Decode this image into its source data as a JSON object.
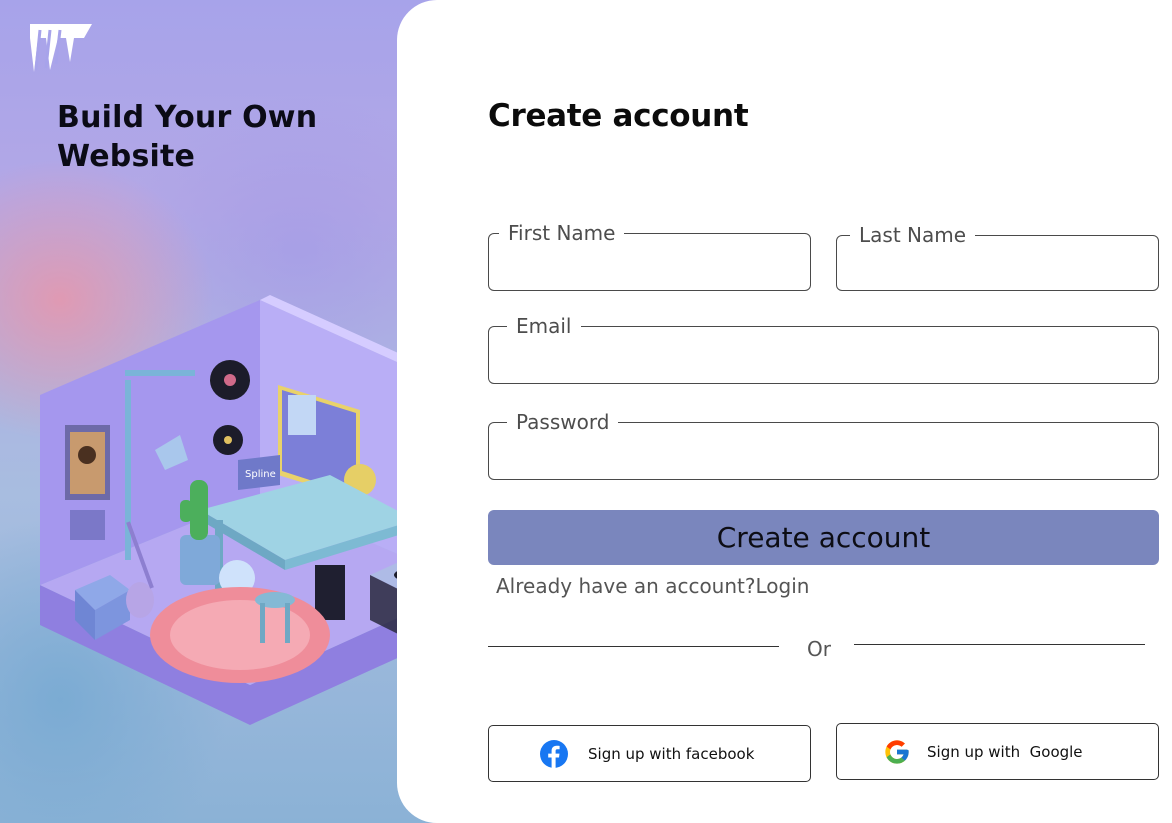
{
  "hero": {
    "title_line1": "Build Your Own",
    "title_line2": "Website",
    "logo_icon": "brand-logo-icon",
    "illustration_text": "Spline",
    "colors": {
      "pink": "#e897aa",
      "lavender": "#a7a3ea",
      "blue": "#8bb2d6"
    }
  },
  "form": {
    "title": "Create account",
    "first_name": {
      "label": "First Name",
      "value": ""
    },
    "last_name": {
      "label": "Last Name",
      "value": ""
    },
    "email": {
      "label": "Email",
      "value": ""
    },
    "password": {
      "label": "Password",
      "value": ""
    },
    "submit_label": "Create account",
    "login_prompt": "Already have an account?",
    "login_link": "Login",
    "divider_text": "Or",
    "facebook_label": "Sign up with facebook",
    "google_label": "Sign up with  Google",
    "colors": {
      "primary_button": "#7a86bd",
      "facebook": "#1877f2"
    }
  }
}
